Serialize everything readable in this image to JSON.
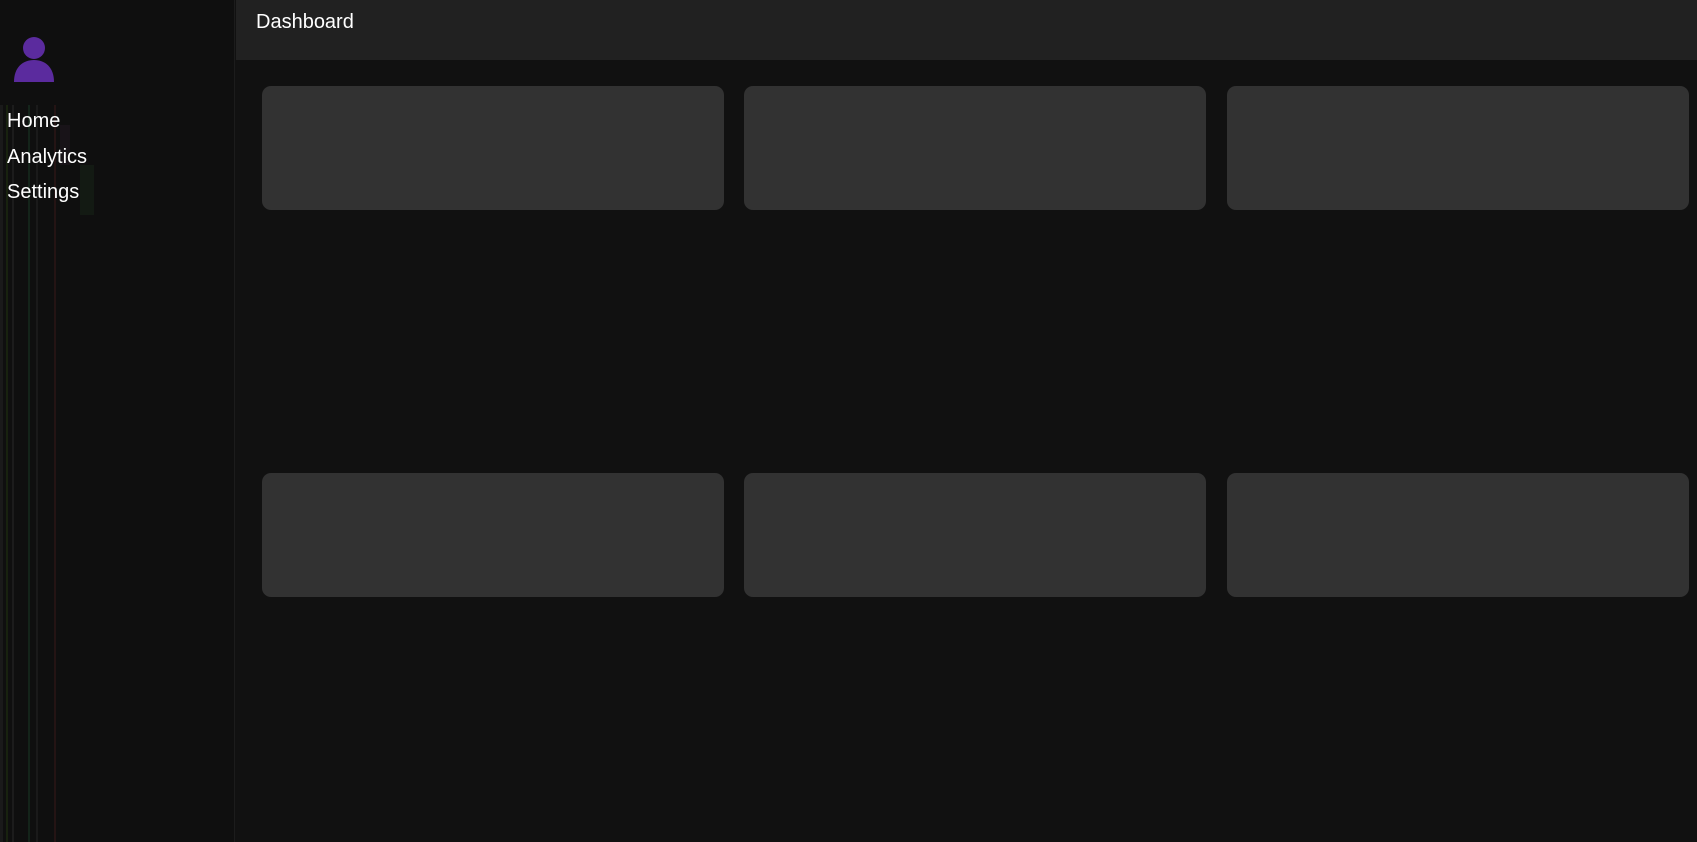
{
  "sidebar": {
    "avatar_icon": "user-avatar-icon",
    "avatar_color": "#5b2b9e",
    "items": [
      {
        "label": "Home"
      },
      {
        "label": "Analytics"
      },
      {
        "label": "Settings"
      }
    ]
  },
  "header": {
    "title": "Dashboard"
  },
  "colors": {
    "background": "#111111",
    "sidebar": "#0f0f0f",
    "header": "#212121",
    "card": "#323232",
    "text": "#ffffff"
  }
}
